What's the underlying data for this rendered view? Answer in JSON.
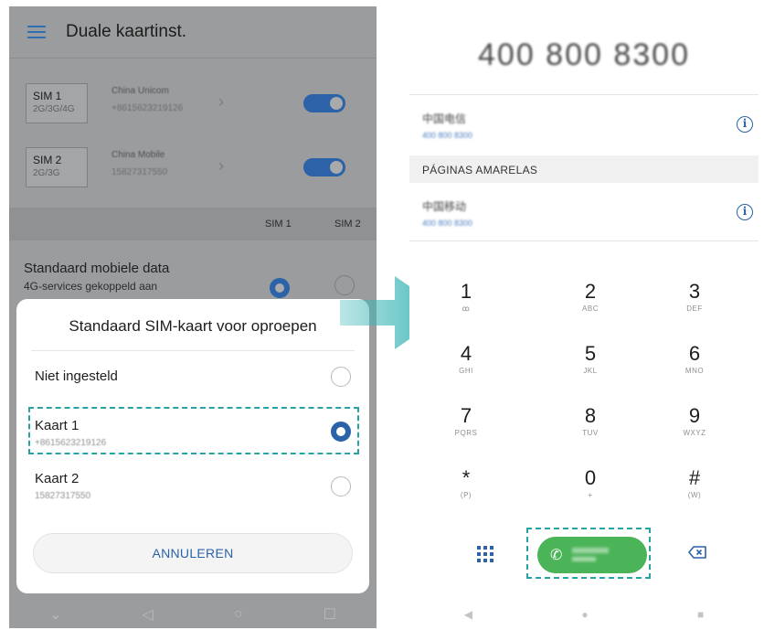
{
  "left_screen": {
    "header": {
      "title": "Duale kaartinst."
    },
    "sim_rows": [
      {
        "slot": "SIM 1",
        "tech": "2G/3G/4G",
        "carrier": "China Unicom",
        "number": "+8615623219126",
        "enabled": true
      },
      {
        "slot": "SIM 2",
        "tech": "2G/3G",
        "carrier": "China Mobile",
        "number": "15827317550",
        "enabled": true
      }
    ],
    "columns": {
      "sim1": "SIM 1",
      "sim2": "SIM 2"
    },
    "default_data": {
      "title": "Standaard mobiele data",
      "subtitle": "4G-services gekoppeld aan"
    },
    "dialog": {
      "title": "Standaard SIM-kaart voor oproepen",
      "options": [
        {
          "label": "Niet ingesteld",
          "number": "",
          "selected": false
        },
        {
          "label": "Kaart 1",
          "number": "+8615623219126",
          "selected": true
        },
        {
          "label": "Kaart 2",
          "number": "15827317550",
          "selected": false
        }
      ],
      "cancel_label": "ANNULEREN"
    },
    "nav": {
      "back": "◁",
      "home": "○",
      "recents": "☐",
      "down": "⌄"
    }
  },
  "right_screen": {
    "dialed_number": "400 800 8300",
    "contacts": [
      {
        "name": "中国电信",
        "sub": "400 800 8300"
      },
      {
        "name": "中国移动",
        "sub": "400 800 8300"
      }
    ],
    "section_label": "PÁGINAS AMARELAS",
    "info_glyph": "i",
    "keys": [
      {
        "digit": "1",
        "letters": "ꝏ"
      },
      {
        "digit": "2",
        "letters": "ABC"
      },
      {
        "digit": "3",
        "letters": "DEF"
      },
      {
        "digit": "4",
        "letters": "GHI"
      },
      {
        "digit": "5",
        "letters": "JKL"
      },
      {
        "digit": "6",
        "letters": "MNO"
      },
      {
        "digit": "7",
        "letters": "PQRS"
      },
      {
        "digit": "8",
        "letters": "TUV"
      },
      {
        "digit": "9",
        "letters": "WXYZ"
      },
      {
        "digit": "*",
        "letters": "(P)"
      },
      {
        "digit": "0",
        "letters": "+"
      },
      {
        "digit": "#",
        "letters": "(W)"
      }
    ],
    "call_glyph": "✆",
    "nav": {
      "back": "◀",
      "home": "●",
      "recents": "■"
    }
  },
  "colors": {
    "accent": "#2b62a8",
    "call_green": "#4bb358",
    "highlight_dash": "#27a3a5",
    "arrow": "#3fb6b6"
  },
  "icons": [
    "hamburger-icon",
    "chevron-right-icon",
    "toggle-switch",
    "radio-button",
    "info-icon",
    "dialpad-icon",
    "phone-icon",
    "backspace-icon"
  ]
}
